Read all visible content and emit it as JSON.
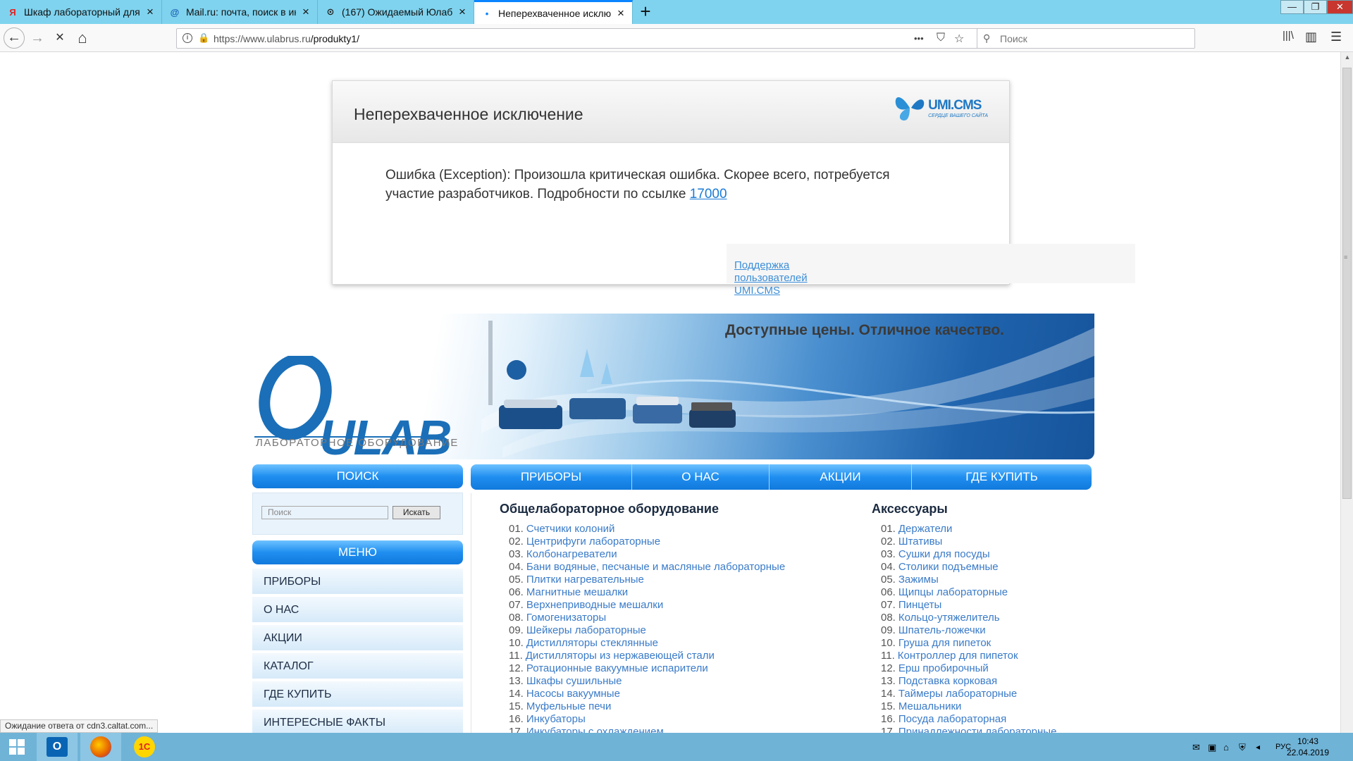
{
  "browser": {
    "tabs": [
      {
        "favicon": "Я",
        "favicon_color": "#e62020",
        "title": "Шкаф лабораторный для хим"
      },
      {
        "favicon": "@",
        "favicon_color": "#1a5fb4",
        "title": "Mail.ru: почта, поиск в интер"
      },
      {
        "favicon": "⊙",
        "favicon_color": "#222222",
        "title": "(167) Ожидаемый Юлаб"
      },
      {
        "favicon": "•",
        "favicon_color": "#0a84ff",
        "title": "Неперехваченное исключени"
      }
    ],
    "new_tab": "+",
    "window_buttons": {
      "minimize": "—",
      "restore": "❐",
      "close": "✕"
    },
    "nav": {
      "back": "←",
      "forward": "→",
      "stop": "✕",
      "home": "⌂"
    },
    "url_host": "https://www.ulabrus.ru",
    "url_path": "/produkty1/",
    "url_actions": {
      "more": "•••",
      "pocket": "⛉",
      "bookmark": "☆"
    },
    "search_placeholder": "Поиск",
    "right_tools": {
      "library": "|||\\",
      "sidebar": "▥",
      "menu": "☰"
    }
  },
  "error": {
    "title": "Неперехваченное исключение",
    "logo_main": "UMI.CMS",
    "logo_tagline": "СЕРДЦЕ ВАШЕГО САЙТА",
    "message": "Ошибка (Exception): Произошла критическая ошибка. Скорее всего, потребуется участие разработчиков. Подробности по ссылке ",
    "link": "17000",
    "support_line1": "Поддержка",
    "support_line2": "пользователей",
    "support_line3": "UMI.CMS"
  },
  "site": {
    "logo": "ULAB",
    "logo_sub": "ЛАБОРАТОРНОЕ ОБОРУДОВАНИЕ",
    "slogan": "Доступные цены. Отличное качество.",
    "search_header": "ПОИСК",
    "search_placeholder": "Поиск",
    "search_button": "Искать",
    "menu_header": "МЕНЮ",
    "menu": [
      "ПРИБОРЫ",
      "О НАС",
      "АКЦИИ",
      "КАТАЛОГ",
      "ГДЕ КУПИТЬ",
      "ИНТЕРЕСНЫЕ ФАКТЫ"
    ],
    "topnav": [
      "ПРИБОРЫ",
      "О НАС",
      "АКЦИИ",
      "ГДЕ КУПИТЬ"
    ],
    "col1_title": "Общелабораторное оборудование",
    "col1": [
      [
        "01.",
        "Счетчики колоний"
      ],
      [
        "02.",
        "Центрифуги лабораторные"
      ],
      [
        "03.",
        "Колбонагреватели"
      ],
      [
        "04.",
        "Бани водяные, песчаные и масляные лабораторные"
      ],
      [
        "05.",
        "Плитки нагревательные"
      ],
      [
        "06.",
        "Магнитные мешалки"
      ],
      [
        "07.",
        "Верхнеприводные мешалки"
      ],
      [
        "08.",
        "Гомогенизаторы"
      ],
      [
        "09.",
        "Шейкеры лабораторные"
      ],
      [
        "10.",
        "Дистилляторы стеклянные"
      ],
      [
        "11.",
        "Дистилляторы из нержавеющей стали"
      ],
      [
        "12.",
        "Ротационные вакуумные испарители"
      ],
      [
        "13.",
        "Шкафы сушильные"
      ],
      [
        "14.",
        "Насосы вакуумные"
      ],
      [
        "15.",
        "Муфельные печи"
      ],
      [
        "16.",
        "Инкубаторы"
      ],
      [
        "17.",
        "Инкубаторы с охлаждением"
      ]
    ],
    "col2_title": "Аксессуары",
    "col2": [
      [
        "01.",
        "Держатели"
      ],
      [
        "02.",
        "Штативы"
      ],
      [
        "03.",
        "Сушки для посуды"
      ],
      [
        "04.",
        "Столики подъемные"
      ],
      [
        "05.",
        "Зажимы"
      ],
      [
        "06.",
        "Щипцы лабораторные"
      ],
      [
        "07.",
        "Пинцеты"
      ],
      [
        "08.",
        "Кольцо-утяжелитель"
      ],
      [
        "09.",
        "Шпатель-ложечки"
      ],
      [
        "10.",
        "Груша для пипеток"
      ],
      [
        "11.",
        "Контроллер для пипеток"
      ],
      [
        "12.",
        "Ерш пробирочный"
      ],
      [
        "13.",
        "Подставка корковая"
      ],
      [
        "14.",
        "Таймеры лабораторные"
      ],
      [
        "15.",
        "Мешальники"
      ],
      [
        "16.",
        "Посуда лабораторная"
      ],
      [
        "17.",
        "Принадлежности лабораторные"
      ]
    ]
  },
  "status_text": "Ожидание ответа от cdn3.caltat.com...",
  "taskbar": {
    "apps": [
      {
        "label": "O",
        "color": "#0a64b4"
      },
      {
        "label": "ff",
        "color": "#e66000"
      },
      {
        "label": "1С",
        "color": "#e02020"
      }
    ],
    "lang": "РУС",
    "time": "10:43",
    "date": "22.04.2019"
  }
}
